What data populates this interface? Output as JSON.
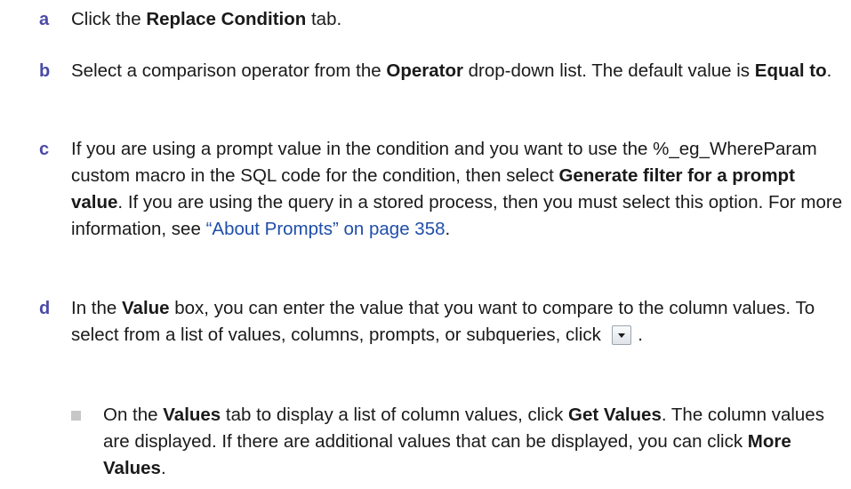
{
  "steps": [
    {
      "marker": "a",
      "segments": [
        {
          "t": "Click the "
        },
        {
          "t": "Replace Condition",
          "b": true
        },
        {
          "t": " tab."
        }
      ]
    },
    {
      "marker": "b",
      "segments": [
        {
          "t": "Select a comparison operator from the "
        },
        {
          "t": "Operator",
          "b": true
        },
        {
          "t": " drop-down list. The default value is "
        },
        {
          "t": "Equal to",
          "b": true
        },
        {
          "t": "."
        }
      ]
    },
    {
      "marker": "c",
      "segments": [
        {
          "t": "If you are using a prompt value in the condition and you want to use the %_eg_WhereParam custom macro in the SQL code for the condition, then select "
        },
        {
          "t": "Generate filter for a prompt value",
          "b": true
        },
        {
          "t": ". If you are using the query in a stored process, then you must select this option. For more information, see "
        },
        {
          "t": "“About Prompts” on page 358",
          "link": true
        },
        {
          "t": "."
        }
      ]
    },
    {
      "marker": "d",
      "segments": [
        {
          "t": "In the "
        },
        {
          "t": "Value",
          "b": true
        },
        {
          "t": " box, you can enter the value that you want to compare to the column values. To select from a list of values, columns, prompts, or subqueries, click "
        },
        {
          "icon": "dropdown-arrow-icon"
        },
        {
          "t": " ."
        }
      ]
    }
  ],
  "bullets": [
    {
      "segments": [
        {
          "t": "On the "
        },
        {
          "t": "Values",
          "b": true
        },
        {
          "t": " tab to display a list of column values, click "
        },
        {
          "t": "Get Values",
          "b": true
        },
        {
          "t": ". The column values are displayed. If there are additional values that can be displayed, you can click "
        },
        {
          "t": "More Values",
          "b": true
        },
        {
          "t": "."
        }
      ]
    }
  ]
}
